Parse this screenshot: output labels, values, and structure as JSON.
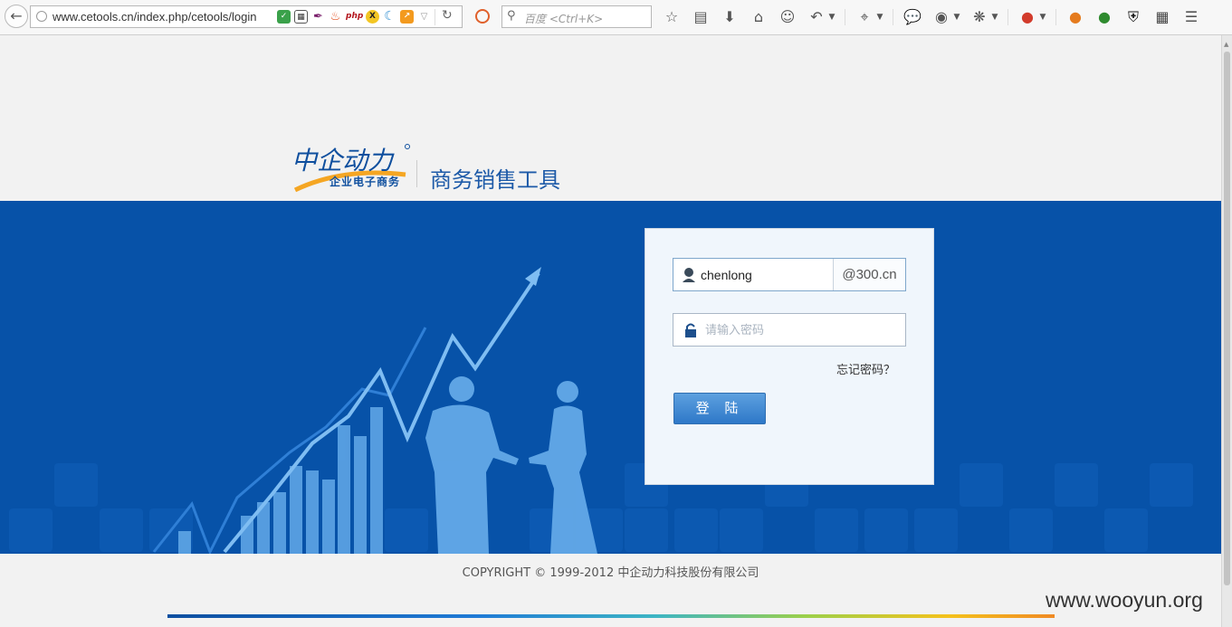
{
  "browser": {
    "url": "www.cetools.cn/index.php/cetools/login",
    "search_placeholder": "百度 <Ctrl+K>",
    "extension_php_label": "php",
    "extension_x_label": "X"
  },
  "page": {
    "logo_text": "中企动力",
    "logo_subtitle": "企业电子商务",
    "product_title": "商务销售工具",
    "login": {
      "username_value": "chenlong",
      "domain_suffix": "@300.cn",
      "password_placeholder": "请输入密码",
      "forgot_password": "忘记密码？",
      "login_button": "登 陆"
    },
    "copyright": "COPYRIGHT © 1999-2012 中企动力科技股份有限公司"
  },
  "watermark": "www.wooyun.org",
  "colors": {
    "banner_blue": "#0752a8",
    "brand_blue": "#1d5aa8",
    "login_button": "#3f88d4",
    "logo_orange": "#f5a623"
  },
  "icons": [
    "back-arrow-icon",
    "globe-icon",
    "shield-check-icon",
    "qr-code-icon",
    "feather-icon",
    "fire-icon",
    "php-icon",
    "x-icon",
    "moon-icon",
    "chart-icon",
    "dropdown-icon",
    "reload-icon",
    "no-entry-icon",
    "search-icon",
    "star-icon",
    "clipboard-icon",
    "download-icon",
    "home-icon",
    "chat-icon",
    "undo-icon",
    "crop-icon",
    "speech-bubble-icon",
    "disc-icon",
    "bug-icon",
    "flag-icon",
    "firebug-icon",
    "green-orb-icon",
    "shield-icon",
    "brick-icon",
    "menu-icon",
    "user-icon",
    "lock-icon"
  ]
}
